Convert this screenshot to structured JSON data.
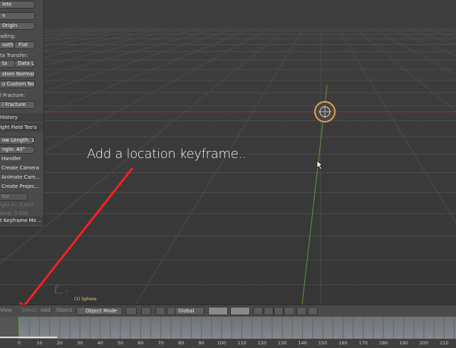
{
  "tool_panel": {
    "items": [
      "lete",
      "n",
      "Origin",
      "ading:",
      "ooth",
      "Flat",
      "ta Transfer:",
      "ta",
      "Data La",
      "stom Normal T...",
      "o Custom Nor...",
      "l Fracture:",
      "l Fracture",
      "History",
      "ight Field Too's",
      "ow Length:  1",
      "ngle:       40°",
      "Handler",
      "Create Camera",
      "Animate Cam...",
      "Create Projec...",
      "tur",
      "ight In: 2.000",
      "lend:   0.000",
      "t Keyframe Me..."
    ]
  },
  "viewport": {
    "annotation": "Add a location keyframe..",
    "object_label": "(1) Sphere",
    "axis_x": "x",
    "axis_y": "y"
  },
  "toolbar": {
    "view": "View",
    "select": "Select",
    "add": "Add",
    "object": "Object",
    "mode": "Object Mode",
    "orientation": "Global"
  },
  "timeline": {
    "current_frame": 0,
    "ticks": [
      "0",
      "10",
      "20",
      "30",
      "40",
      "50",
      "60",
      "70",
      "80",
      "90",
      "100",
      "110",
      "120",
      "130",
      "140",
      "150",
      "160",
      "170",
      "180",
      "190",
      "200",
      "210"
    ]
  },
  "colors": {
    "x_axis": "#c0392b",
    "y_axis": "#5a9a3a",
    "arrow": "#ff2020",
    "object": "#e8a050"
  }
}
